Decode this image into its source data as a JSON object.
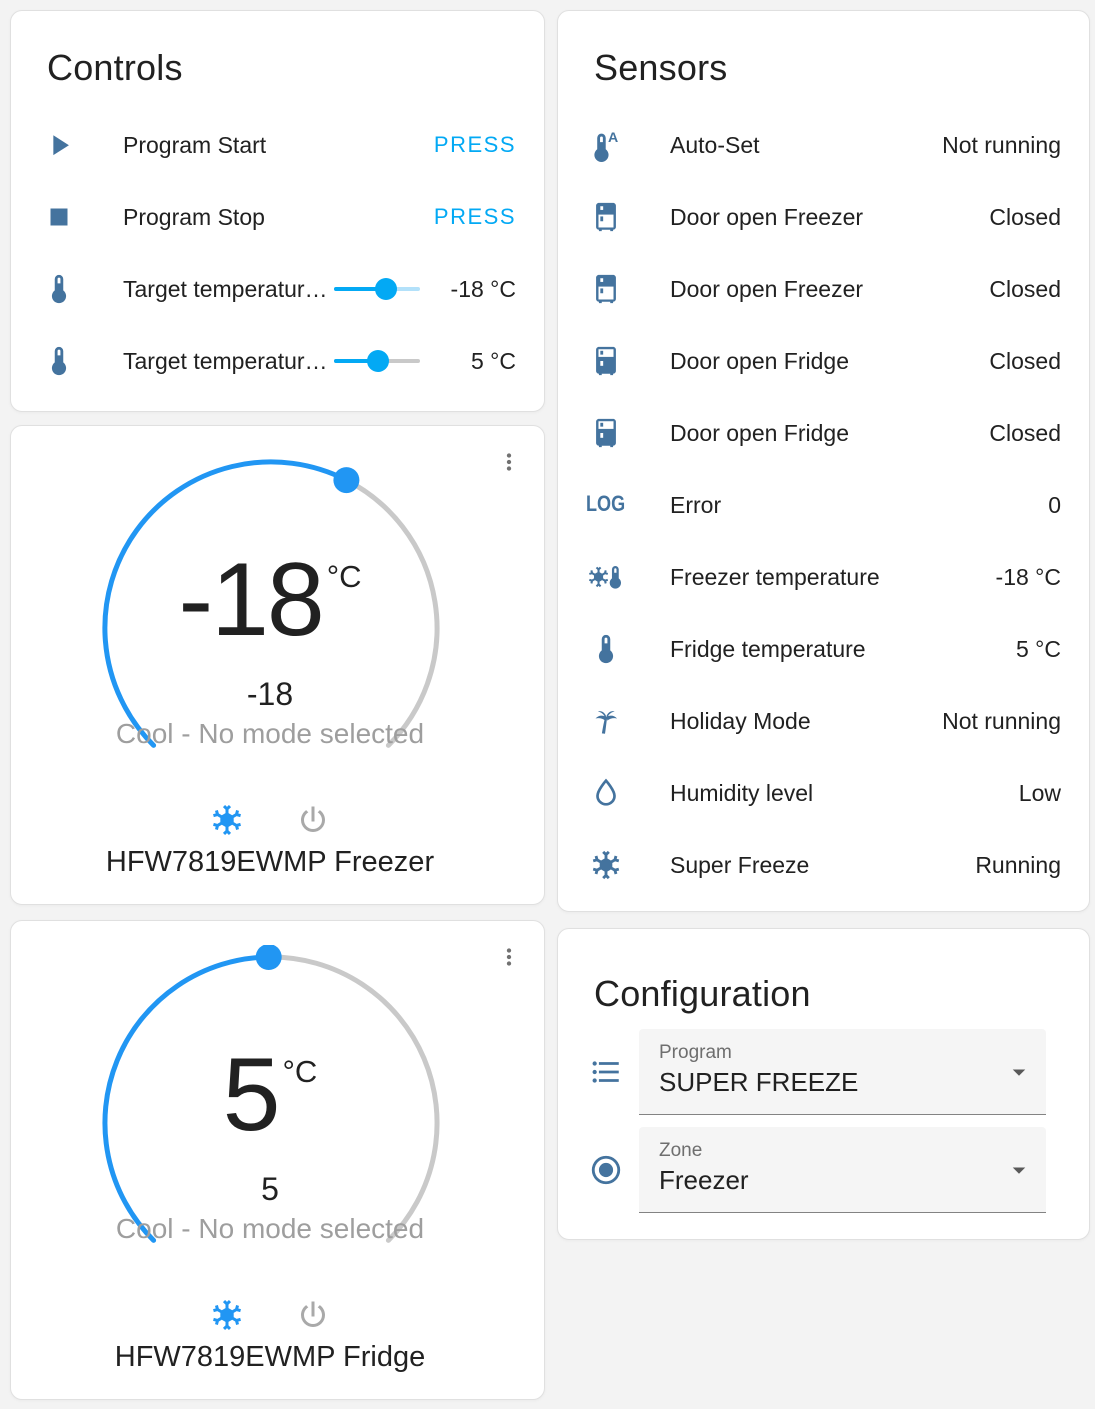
{
  "colors": {
    "accent": "#03a9f4",
    "dial_blue": "#2196f3",
    "icon_blue": "#44739e",
    "track_gray": "#c9c9c9",
    "slider_rest_light_blue": "#b3e1fa",
    "text_main": "#212121",
    "text_secondary": "#9e9e9e"
  },
  "controls": {
    "title": "Controls",
    "rows": [
      {
        "icon": "play-icon",
        "label": "Program Start",
        "action": "PRESS"
      },
      {
        "icon": "stop-icon",
        "label": "Program Stop",
        "action": "PRESS"
      },
      {
        "icon": "thermometer-icon",
        "label": "Target temperatur…",
        "value": "-18 °C",
        "fraction": 0.6,
        "rest_color": "#b3e1fa"
      },
      {
        "icon": "thermometer-icon",
        "label": "Target temperatur…",
        "value": "5 °C",
        "fraction": 0.51,
        "rest_color": "#c9c9c9"
      }
    ]
  },
  "sensors": {
    "title": "Sensors",
    "rows": [
      {
        "icon": "thermometer-auto-icon",
        "label": "Auto-Set",
        "value": "Not running"
      },
      {
        "icon": "fridge-top-icon",
        "label": "Door open Freezer",
        "value": "Closed"
      },
      {
        "icon": "fridge-top-icon",
        "label": "Door open Freezer",
        "value": "Closed"
      },
      {
        "icon": "fridge-bottom-icon",
        "label": "Door open Fridge",
        "value": "Closed"
      },
      {
        "icon": "fridge-bottom-icon",
        "label": "Door open Fridge",
        "value": "Closed"
      },
      {
        "icon": "log-icon",
        "label": "Error",
        "value": "0"
      },
      {
        "icon": "snowflake-thermometer-icon",
        "label": "Freezer temperature",
        "value": "-18 °C"
      },
      {
        "icon": "thermometer-icon",
        "label": "Fridge temperature",
        "value": "5 °C"
      },
      {
        "icon": "palm-tree-icon",
        "label": "Holiday Mode",
        "value": "Not running"
      },
      {
        "icon": "water-drop-icon",
        "label": "Humidity level",
        "value": "Low"
      },
      {
        "icon": "snowflake-icon",
        "label": "Super Freeze",
        "value": "Running"
      }
    ]
  },
  "freezer_card": {
    "value": "-18",
    "unit": "°C",
    "target": "-18",
    "status": "Cool - No mode selected",
    "name": "HFW7819EWMP Freezer",
    "knob_fraction": 0.6,
    "modes": [
      {
        "icon": "snowflake-icon",
        "state": "active"
      },
      {
        "icon": "power-icon",
        "state": "inactive"
      }
    ]
  },
  "fridge_card": {
    "value": "5",
    "unit": "°C",
    "target": "5",
    "status": "Cool - No mode selected",
    "name": "HFW7819EWMP Fridge",
    "knob_fraction": 0.497,
    "modes": [
      {
        "icon": "snowflake-icon",
        "state": "active"
      },
      {
        "icon": "power-icon",
        "state": "inactive"
      }
    ]
  },
  "configuration": {
    "title": "Configuration",
    "fields": [
      {
        "icon": "format-list-bulleted-icon",
        "label": "Program",
        "value": "SUPER FREEZE"
      },
      {
        "icon": "radiobox-marked-icon",
        "label": "Zone",
        "value": "Freezer"
      }
    ]
  }
}
